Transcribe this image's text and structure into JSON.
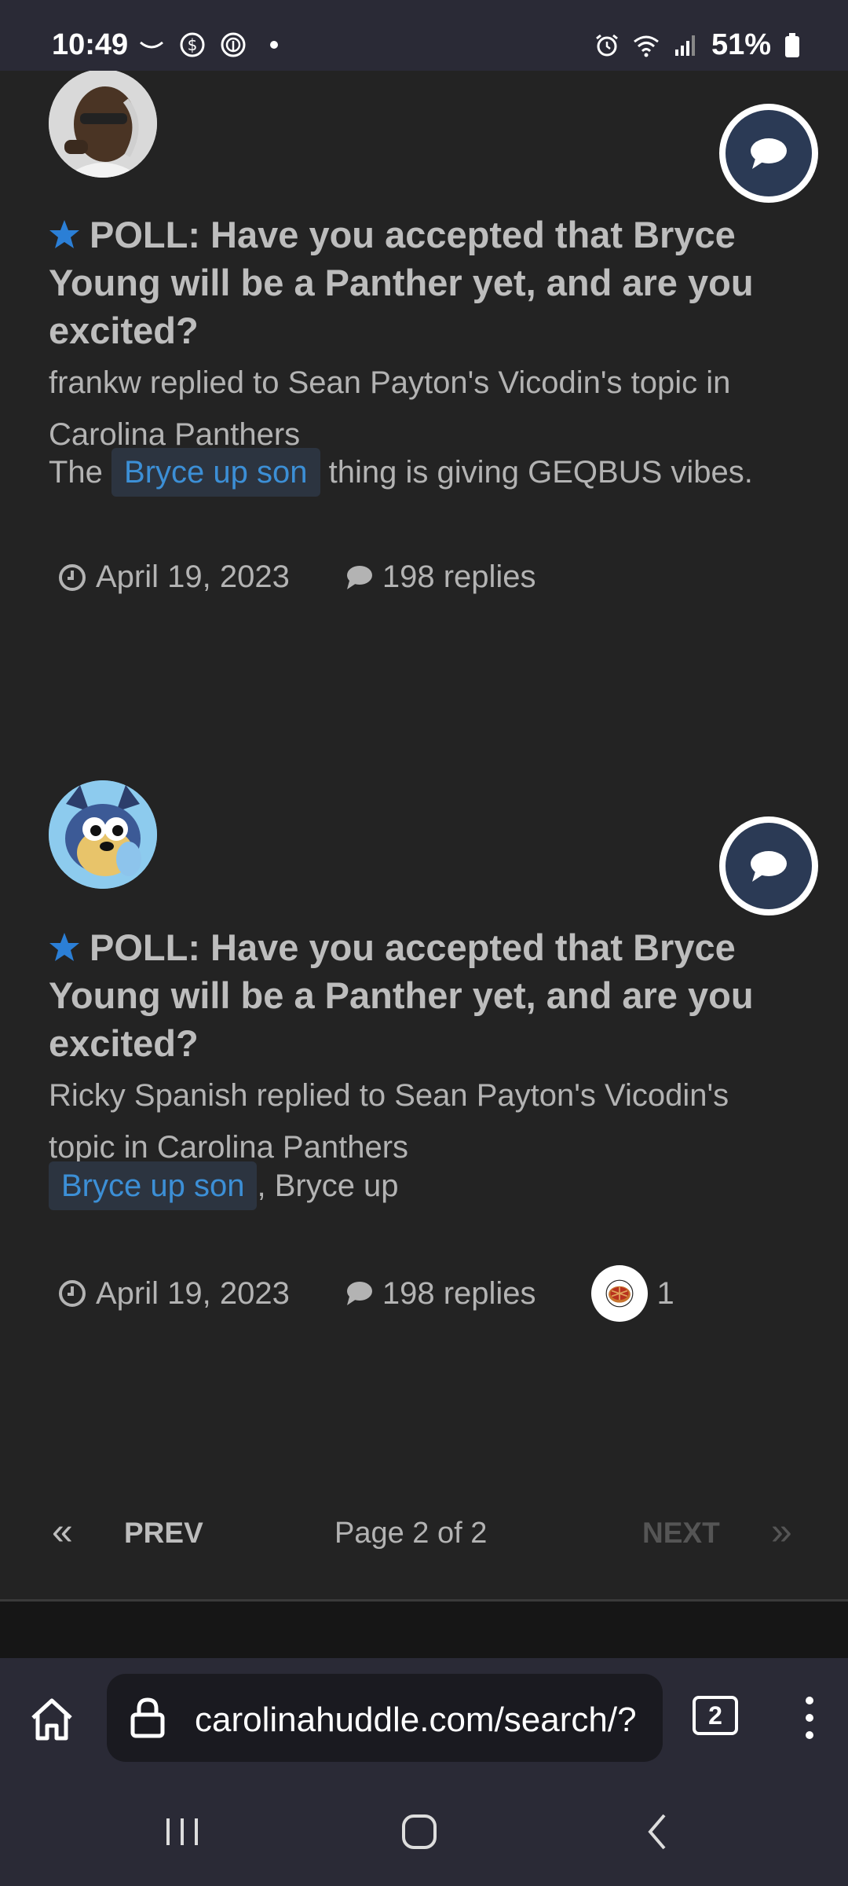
{
  "status_bar": {
    "time": "10:49",
    "battery": "51%",
    "left_icons": [
      "missed-call-icon",
      "dollar-circle-icon",
      "fingerprint-icon",
      "dot-icon"
    ],
    "right_icons": [
      "alarm-icon",
      "wifi-icon",
      "signal-icon",
      "battery-icon"
    ]
  },
  "results": [
    {
      "title": "POLL: Have you accepted that Bryce Young will be a Panther yet, and are you excited?",
      "meta": "frankw replied to Sean Payton's Vicodin's topic in Carolina Panthers",
      "snippet_before": "The ",
      "snippet_tag": "Bryce up son",
      "snippet_after": " thing is giving GEQBUS vibes.",
      "date": "April 19, 2023",
      "replies": "198 replies"
    },
    {
      "title": "POLL: Have you accepted that Bryce Young will be a Panther yet, and are you excited?",
      "meta": "Ricky Spanish replied to Sean Payton's Vicodin's topic in Carolina Panthers",
      "snippet_before": "",
      "snippet_tag": "Bryce up son",
      "snippet_after": ", Bryce up",
      "date": "April 19, 2023",
      "replies": "198 replies",
      "reaction_count": "1"
    }
  ],
  "pagination": {
    "prev_arrow": "«",
    "prev": "PREV",
    "info": "Page 2 of 2",
    "next": "NEXT",
    "next_arrow": "»"
  },
  "browser": {
    "url": "carolinahuddle.com/search/?",
    "tab_count": "2"
  },
  "colors": {
    "accent_blue": "#3c8fd6",
    "card_bg": "#232323",
    "page_bg": "#161616",
    "bar_bg": "#2a2a36"
  }
}
